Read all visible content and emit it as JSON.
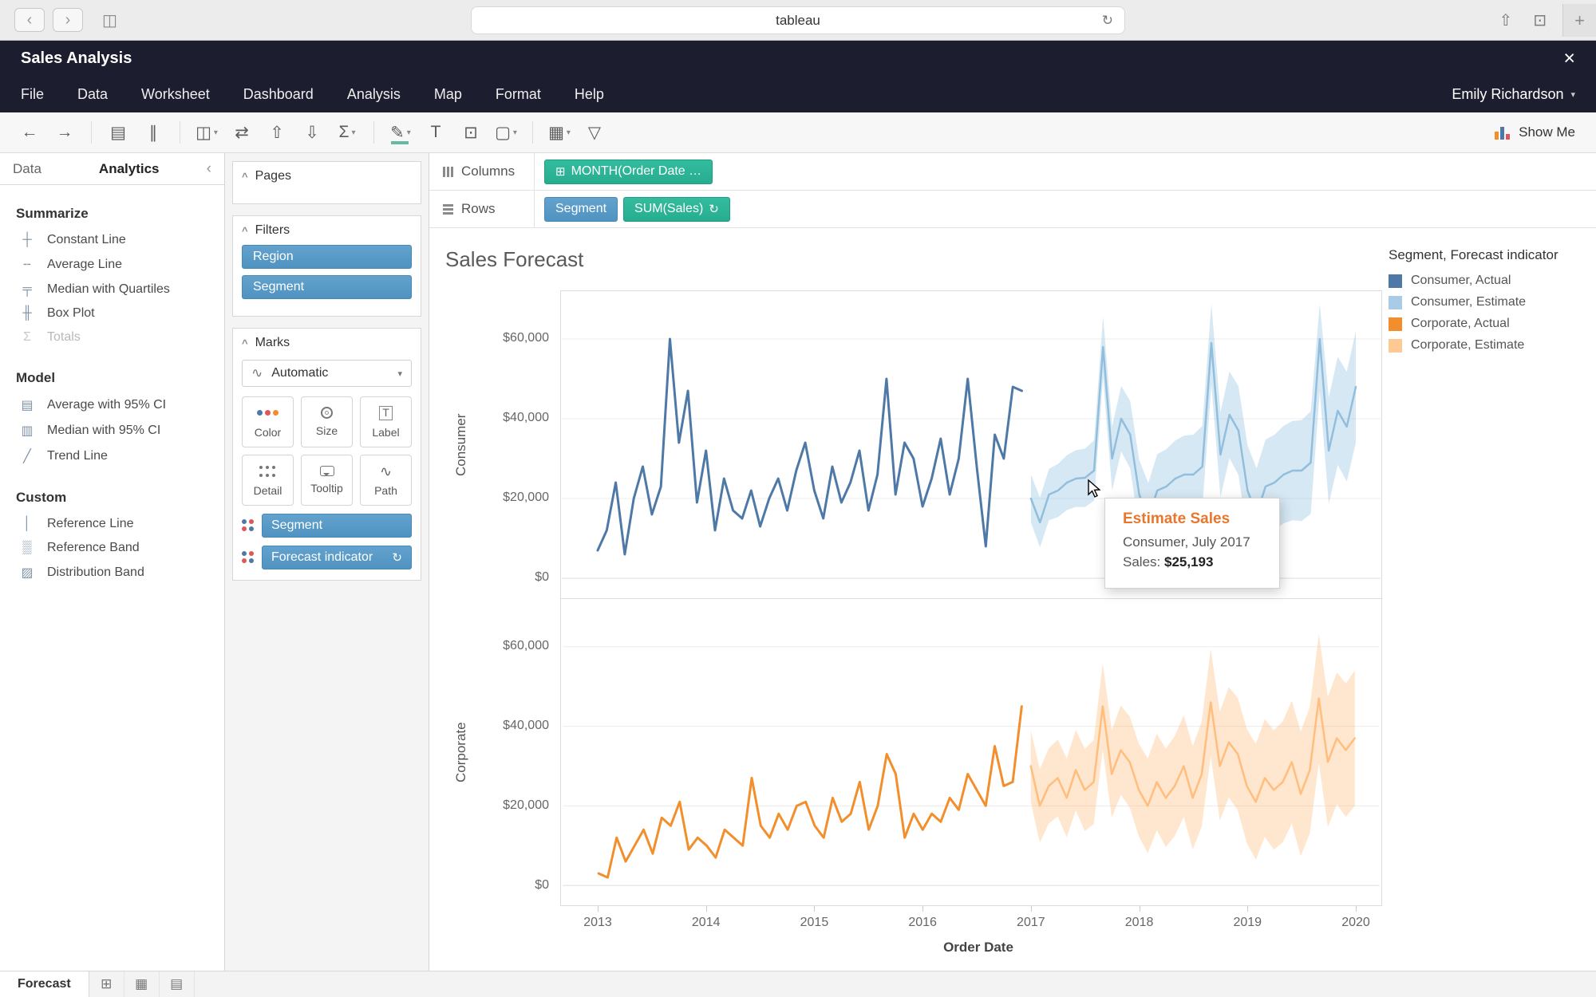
{
  "browser": {
    "url_text": "tableau"
  },
  "app": {
    "title": "Sales Analysis",
    "user": "Emily Richardson"
  },
  "menus": [
    "File",
    "Data",
    "Worksheet",
    "Dashboard",
    "Analysis",
    "Map",
    "Format",
    "Help"
  ],
  "toolbar": {
    "show_me_label": "Show Me",
    "buttons": [
      {
        "name": "undo"
      },
      {
        "name": "redo"
      },
      {
        "sep": true
      },
      {
        "name": "new-data-source"
      },
      {
        "name": "pause-auto-updates"
      },
      {
        "sep": true
      },
      {
        "name": "new-worksheet",
        "caret": true
      },
      {
        "name": "swap-rows-columns"
      },
      {
        "name": "sort-ascending"
      },
      {
        "name": "sort-descending"
      },
      {
        "name": "totals",
        "caret": true
      },
      {
        "sep": true
      },
      {
        "name": "highlight",
        "caret": true,
        "accent": true
      },
      {
        "name": "show-mark-labels"
      },
      {
        "name": "fix-axes"
      },
      {
        "name": "cell-size",
        "caret": true
      },
      {
        "sep": true
      },
      {
        "name": "show-hide-cards",
        "caret": true
      },
      {
        "name": "presentation-mode"
      }
    ]
  },
  "analytics_pane": {
    "tabs": [
      "Data",
      "Analytics"
    ],
    "active_tab": "Analytics",
    "sections": [
      {
        "title": "Summarize",
        "items": [
          {
            "label": "Constant Line",
            "icon": "constant-line-icon"
          },
          {
            "label": "Average Line",
            "icon": "average-line-icon"
          },
          {
            "label": "Median with Quartiles",
            "icon": "median-quartiles-icon"
          },
          {
            "label": "Box Plot",
            "icon": "box-plot-icon"
          },
          {
            "label": "Totals",
            "icon": "totals-icon",
            "disabled": true
          }
        ]
      },
      {
        "title": "Model",
        "items": [
          {
            "label": "Average with 95% CI",
            "icon": "average-ci-icon"
          },
          {
            "label": "Median with 95% CI",
            "icon": "median-ci-icon"
          },
          {
            "label": "Trend Line",
            "icon": "trend-line-icon"
          }
        ]
      },
      {
        "title": "Custom",
        "items": [
          {
            "label": "Reference Line",
            "icon": "reference-line-icon"
          },
          {
            "label": "Reference Band",
            "icon": "reference-band-icon"
          },
          {
            "label": "Distribution Band",
            "icon": "distribution-band-icon"
          }
        ]
      }
    ]
  },
  "shelf_cards": {
    "pages": "Pages",
    "filters": "Filters",
    "marks": "Marks"
  },
  "filters": {
    "pills": [
      "Region",
      "Segment"
    ]
  },
  "marks": {
    "type_selector": "Automatic",
    "buttons": [
      {
        "label": "Color",
        "name": "color"
      },
      {
        "label": "Size",
        "name": "size"
      },
      {
        "label": "Label",
        "name": "label"
      },
      {
        "label": "Detail",
        "name": "detail"
      },
      {
        "label": "Tooltip",
        "name": "tooltip"
      },
      {
        "label": "Path",
        "name": "path"
      }
    ],
    "pills": [
      {
        "label": "Segment"
      },
      {
        "label": "Forecast indicator",
        "right_icon": "forecast-indicator-icon"
      }
    ]
  },
  "columns_shelf": {
    "label": "Columns",
    "pills": [
      {
        "label": "MONTH(Order Date …",
        "kind": "continuous",
        "left_icon": "date-hierarchy-icon"
      }
    ]
  },
  "rows_shelf": {
    "label": "Rows",
    "pills": [
      {
        "label": "Segment",
        "kind": "discrete"
      },
      {
        "label": "SUM(Sales)",
        "kind": "continuous",
        "right_icon": "forecast-indicator-icon"
      }
    ]
  },
  "sheet": {
    "title": "Sales Forecast"
  },
  "legend": {
    "title": "Segment, Forecast indicator",
    "items": [
      {
        "label": "Consumer, Actual",
        "color": "#4e79a7"
      },
      {
        "label": "Consumer, Estimate",
        "color": "#a8cce5"
      },
      {
        "label": "Corporate, Actual",
        "color": "#f28e2b"
      },
      {
        "label": "Corporate, Estimate",
        "color": "#ffc993"
      }
    ]
  },
  "tooltip": {
    "title": "Estimate Sales",
    "subtitle": "Consumer, July 2017",
    "sales_label": "Sales: ",
    "sales_value": "$25,193"
  },
  "bottom_bar": {
    "tabs": [
      {
        "label": "Forecast",
        "active": true
      }
    ],
    "buttons": [
      "new-worksheet",
      "new-dashboard",
      "new-story"
    ]
  },
  "chart_data": {
    "type": "line",
    "title": "Sales Forecast",
    "xlabel": "Order Date",
    "x_ticks": [
      "2013",
      "2014",
      "2015",
      "2016",
      "2017",
      "2018",
      "2019",
      "2020"
    ],
    "x_start": "2013-01",
    "frequency": "monthly",
    "forecast_start": "2017-01",
    "ylim": [
      0,
      65000
    ],
    "y_ticks": [
      {
        "label": "$0",
        "value": 0
      },
      {
        "label": "$20,000",
        "value": 20000
      },
      {
        "label": "$40,000",
        "value": 40000
      },
      {
        "label": "$60,000",
        "value": 60000
      }
    ],
    "panels": [
      {
        "name": "Consumer",
        "actual": {
          "label": "Consumer, Actual",
          "color": "#4e79a7",
          "values": [
            7000,
            12000,
            24000,
            6000,
            20000,
            28000,
            16000,
            23000,
            60000,
            34000,
            47000,
            19000,
            32000,
            12000,
            25000,
            17000,
            15000,
            22000,
            13000,
            20000,
            25000,
            17000,
            27000,
            34000,
            22000,
            15000,
            28000,
            19000,
            24000,
            32000,
            17000,
            26000,
            50000,
            21000,
            34000,
            30000,
            18000,
            25000,
            35000,
            21000,
            30000,
            50000,
            28000,
            8000,
            36000,
            30000,
            48000,
            47000
          ]
        },
        "estimate": {
          "label": "Consumer, Estimate",
          "color": "#92bedd",
          "band_color": "rgba(163,203,231,0.45)",
          "band_spread": [
            6000,
            14000
          ],
          "values": [
            20000,
            14000,
            21000,
            22000,
            24000,
            25000,
            25193,
            27000,
            58000,
            30000,
            40000,
            36000,
            21000,
            15000,
            22000,
            23000,
            25000,
            26000,
            26000,
            28000,
            59000,
            31000,
            41000,
            37000,
            22000,
            16000,
            23000,
            24000,
            26000,
            27000,
            27000,
            29000,
            60000,
            32000,
            42000,
            38000,
            48000
          ]
        },
        "highlighted_point": {
          "month": "July 2017",
          "value": 25193
        }
      },
      {
        "name": "Corporate",
        "actual": {
          "label": "Corporate, Actual",
          "color": "#f28e2b",
          "values": [
            3000,
            2000,
            12000,
            6000,
            10000,
            14000,
            8000,
            17000,
            15000,
            21000,
            9000,
            12000,
            10000,
            7000,
            14000,
            12000,
            10000,
            27000,
            15000,
            12000,
            18000,
            14000,
            20000,
            21000,
            15000,
            12000,
            22000,
            16000,
            18000,
            26000,
            14000,
            20000,
            33000,
            28000,
            12000,
            18000,
            14000,
            18000,
            16000,
            22000,
            19000,
            28000,
            24000,
            20000,
            35000,
            25000,
            26000,
            45000
          ]
        },
        "estimate": {
          "label": "Corporate, Estimate",
          "color": "#ffbe7d",
          "band_color": "rgba(255,190,125,0.38)",
          "band_spread": [
            9000,
            17000
          ],
          "values": [
            30000,
            20000,
            25000,
            27000,
            22000,
            29000,
            24000,
            26000,
            45000,
            28000,
            34000,
            31000,
            24000,
            20000,
            26000,
            22000,
            25000,
            30000,
            22000,
            28000,
            46000,
            30000,
            36000,
            33000,
            25000,
            21000,
            27000,
            24000,
            26000,
            31000,
            23000,
            29000,
            47000,
            31000,
            37000,
            34000,
            37000
          ]
        }
      }
    ]
  }
}
